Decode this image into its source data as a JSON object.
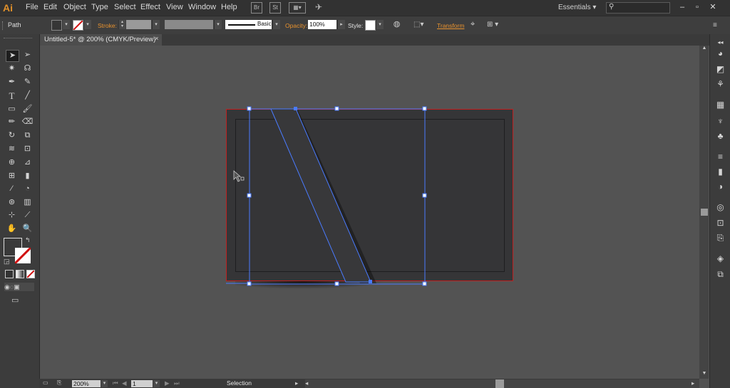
{
  "app": {
    "logo": "Ai"
  },
  "menu": [
    "File",
    "Edit",
    "Object",
    "Type",
    "Select",
    "Effect",
    "View",
    "Window",
    "Help"
  ],
  "menubar_icons": [
    "bridge-icon",
    "stock-icon",
    "arrange-docs-icon",
    "gpu-icon"
  ],
  "workspace": {
    "label": "Essentials"
  },
  "window_buttons": [
    "minimize-icon",
    "maximize-icon",
    "close-icon"
  ],
  "control": {
    "selection_type": "Path",
    "stroke_label": "Stroke:",
    "stroke_style": "Basic",
    "opacity_label": "Opacity:",
    "opacity_value": "100%",
    "style_label": "Style:",
    "transform_label": "Transform"
  },
  "document": {
    "tab_title": "Untitled-5* @ 200% (CMYK/Preview)"
  },
  "status": {
    "zoom": "200%",
    "artboard": "1",
    "tool": "Selection"
  },
  "colors": {
    "accent": "#e8922e",
    "selection": "#4a7bff",
    "artboard_border": "#c02020"
  }
}
